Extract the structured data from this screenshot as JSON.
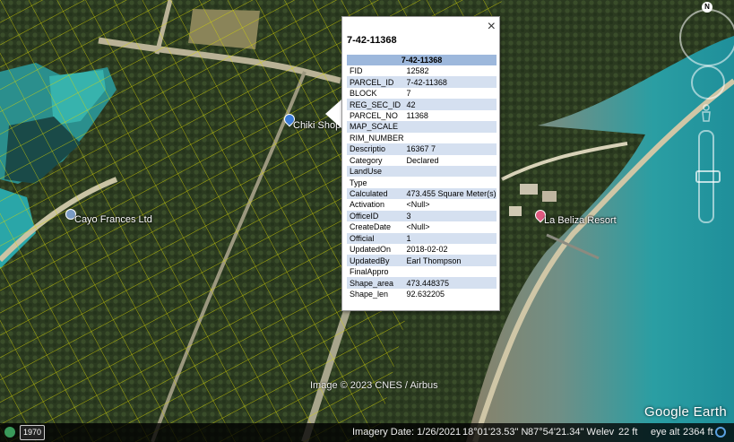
{
  "map": {
    "places": [
      {
        "name": "Chiki Shop"
      },
      {
        "name": "Cayo Frances Ltd"
      },
      {
        "name": "La Beliza Resort"
      }
    ],
    "attribution": "Image © 2023 CNES / Airbus",
    "logo": "Google Earth",
    "colors": {
      "parcel_lines": "#e8e800",
      "land": "#2f3d22",
      "water": "#2aa6a8",
      "popup_header": "#9db8dc",
      "popup_alt_row": "#d5e0f0"
    }
  },
  "status_bar": {
    "historical_button": "1970",
    "imagery_date": "Imagery Date: 1/26/2021",
    "lat": "18°01'23.53\" N",
    "lon": "87°54'21.34\" W",
    "elev_label": "elev",
    "elev_value": "22 ft",
    "eye_alt_label": "eye alt",
    "eye_alt_value": "2364 ft"
  },
  "navigation": {
    "north_label": "N"
  },
  "popup": {
    "title": "7-42-11368",
    "close_icon": "×",
    "table_header": "7-42-11368",
    "rows": [
      {
        "key": "FID",
        "value": "12582"
      },
      {
        "key": "PARCEL_ID",
        "value": "7-42-11368"
      },
      {
        "key": "BLOCK",
        "value": "7"
      },
      {
        "key": "REG_SEC_ID",
        "value": "42"
      },
      {
        "key": "PARCEL_NO",
        "value": "11368"
      },
      {
        "key": "MAP_SCALE",
        "value": ""
      },
      {
        "key": "RIM_NUMBER",
        "value": ""
      },
      {
        "key": "Descriptio",
        "value": "16367 7"
      },
      {
        "key": "Category",
        "value": "Declared"
      },
      {
        "key": "LandUse",
        "value": ""
      },
      {
        "key": "Type",
        "value": ""
      },
      {
        "key": "Calculated",
        "value": "473.455 Square Meter(s)"
      },
      {
        "key": "Activation",
        "value": "<Null>"
      },
      {
        "key": "OfficeID",
        "value": "3"
      },
      {
        "key": "CreateDate",
        "value": "<Null>"
      },
      {
        "key": "Official",
        "value": "1"
      },
      {
        "key": "UpdatedOn",
        "value": "2018-02-02"
      },
      {
        "key": "UpdatedBy",
        "value": "Earl Thompson"
      },
      {
        "key": "FinalAppro",
        "value": ""
      },
      {
        "key": "Shape_area",
        "value": "473.448375"
      },
      {
        "key": "Shape_len",
        "value": "92.632205"
      }
    ]
  }
}
